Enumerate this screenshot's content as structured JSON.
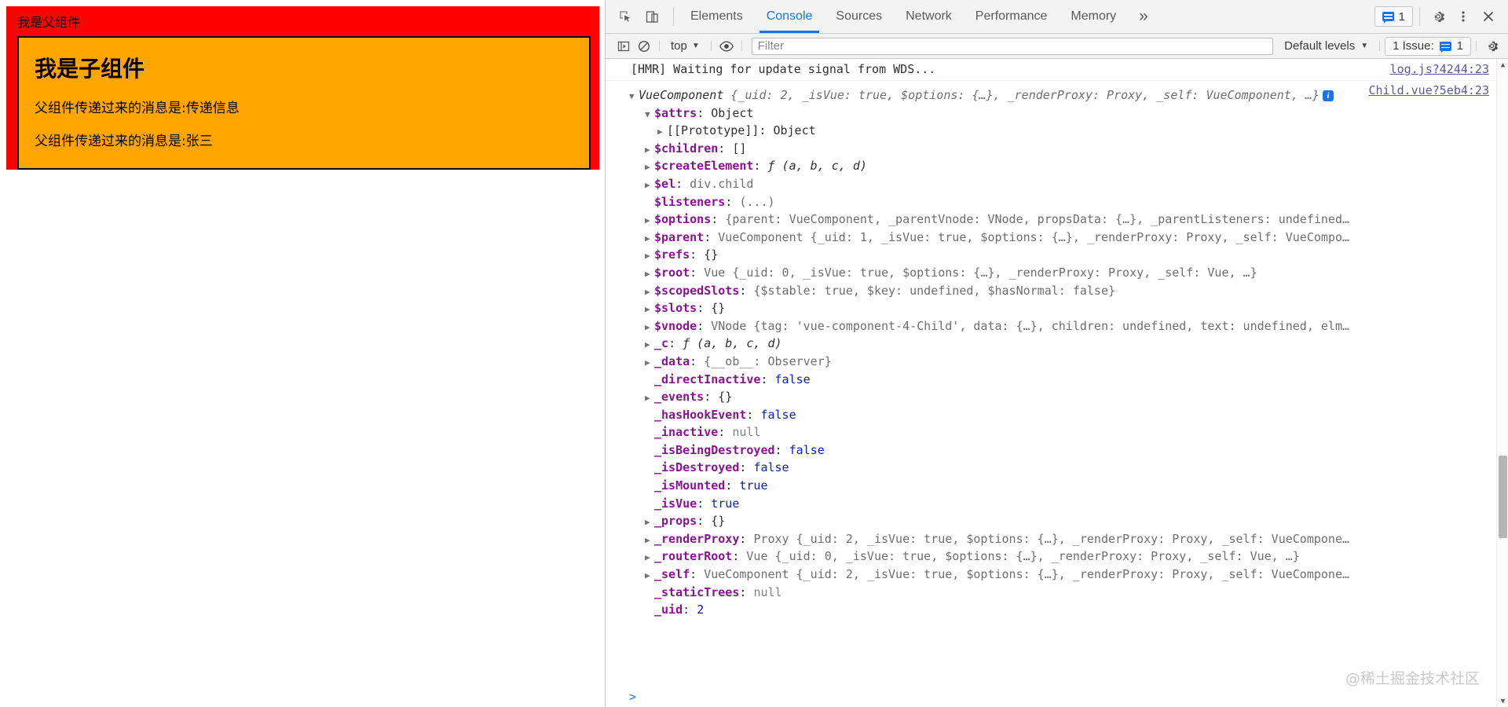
{
  "web_page": {
    "parent_title": "我是父组件",
    "parent_bg": "#ff0000",
    "child_bg": "#ffa500",
    "child_title": "我是子组件",
    "child_messages": [
      "父组件传递过来的消息是:传递信息",
      "父组件传递过来的消息是:张三"
    ]
  },
  "devtools": {
    "tabs": [
      {
        "label": "Elements",
        "active": false
      },
      {
        "label": "Console",
        "active": true
      },
      {
        "label": "Sources",
        "active": false
      },
      {
        "label": "Network",
        "active": false
      },
      {
        "label": "Performance",
        "active": false
      },
      {
        "label": "Memory",
        "active": false
      }
    ],
    "more_tabs_label": "»",
    "inspect_icon": "inspect-element-icon",
    "device_icon": "device-toolbar-icon",
    "message_count": "1",
    "settings_icon": "gear-icon",
    "kebab_icon": "more-options-icon",
    "close_icon": "close-icon",
    "console": {
      "sidebar_icon": "console-sidebar-icon",
      "clear_icon": "clear-console-icon",
      "context": "top",
      "eye_icon": "live-expressions-icon",
      "filter_value": "",
      "filter_placeholder": "Filter",
      "levels_label": "Default levels",
      "issues_label": "1 Issue:",
      "issues_count": "1",
      "console_settings_icon": "gear-icon",
      "accent_color": "#1a73e8"
    }
  },
  "console_log": {
    "hmr_message": "[HMR] Waiting for update signal from WDS...",
    "hmr_source": "log.js?4244:23",
    "object_source": "Child.vue?5eb4:23",
    "root": {
      "class_name": "VueComponent",
      "preview": " {_uid: 2, _isVue: true, $options: {…}, _renderProxy: Proxy, _self: VueComponent, …}"
    },
    "rows": [
      {
        "indent": 1,
        "arrow": "▼",
        "key": "$attrs",
        "sep": ": ",
        "value": "Object",
        "vtype": "cname"
      },
      {
        "indent": 2,
        "arrow": "▶",
        "key": "[[Prototype]]",
        "sep": ": ",
        "value": "Object",
        "vtype": "cname",
        "key_plain": true
      },
      {
        "indent": 1,
        "arrow": "▶",
        "key": "$children",
        "sep": ": ",
        "value": "[]",
        "vtype": "cname"
      },
      {
        "indent": 1,
        "arrow": "▶",
        "key": "$createElement",
        "sep": ": ",
        "value": "ƒ (a, b, c, d)",
        "vtype": "fn"
      },
      {
        "indent": 1,
        "arrow": "▶",
        "key": "$el",
        "sep": ": ",
        "value": "div.child",
        "vtype": "dim"
      },
      {
        "indent": 1,
        "arrow": "",
        "key": "$listeners",
        "sep": ": ",
        "value": "(...)",
        "vtype": "dim"
      },
      {
        "indent": 1,
        "arrow": "▶",
        "key": "$options",
        "sep": ": ",
        "value": "{parent: VueComponent, _parentVnode: VNode, propsData: {…}, _parentListeners: undefined…",
        "vtype": "dim"
      },
      {
        "indent": 1,
        "arrow": "▶",
        "key": "$parent",
        "sep": ": ",
        "value": "VueComponent {_uid: 1, _isVue: true, $options: {…}, _renderProxy: Proxy, _self: VueCompo…",
        "vtype": "dim"
      },
      {
        "indent": 1,
        "arrow": "▶",
        "key": "$refs",
        "sep": ": ",
        "value": "{}",
        "vtype": "cname"
      },
      {
        "indent": 1,
        "arrow": "▶",
        "key": "$root",
        "sep": ": ",
        "value": "Vue {_uid: 0, _isVue: true, $options: {…}, _renderProxy: Proxy, _self: Vue, …}",
        "vtype": "dim"
      },
      {
        "indent": 1,
        "arrow": "▶",
        "key": "$scopedSlots",
        "sep": ": ",
        "value": "{$stable: true, $key: undefined, $hasNormal: false}",
        "vtype": "dim"
      },
      {
        "indent": 1,
        "arrow": "▶",
        "key": "$slots",
        "sep": ": ",
        "value": "{}",
        "vtype": "cname"
      },
      {
        "indent": 1,
        "arrow": "▶",
        "key": "$vnode",
        "sep": ": ",
        "value": "VNode {tag: 'vue-component-4-Child', data: {…}, children: undefined, text: undefined, elm…",
        "vtype": "dim"
      },
      {
        "indent": 1,
        "arrow": "▶",
        "key": "_c",
        "sep": ": ",
        "value": "ƒ (a, b, c, d)",
        "vtype": "fn"
      },
      {
        "indent": 1,
        "arrow": "▶",
        "key": "_data",
        "sep": ": ",
        "value": "{__ob__: Observer}",
        "vtype": "dim"
      },
      {
        "indent": 1,
        "arrow": "",
        "key": "_directInactive",
        "sep": ": ",
        "value": "false",
        "vtype": "bool"
      },
      {
        "indent": 1,
        "arrow": "▶",
        "key": "_events",
        "sep": ": ",
        "value": "{}",
        "vtype": "cname"
      },
      {
        "indent": 1,
        "arrow": "",
        "key": "_hasHookEvent",
        "sep": ": ",
        "value": "false",
        "vtype": "bool"
      },
      {
        "indent": 1,
        "arrow": "",
        "key": "_inactive",
        "sep": ": ",
        "value": "null",
        "vtype": "nul"
      },
      {
        "indent": 1,
        "arrow": "",
        "key": "_isBeingDestroyed",
        "sep": ": ",
        "value": "false",
        "vtype": "bool"
      },
      {
        "indent": 1,
        "arrow": "",
        "key": "_isDestroyed",
        "sep": ": ",
        "value": "false",
        "vtype": "bool"
      },
      {
        "indent": 1,
        "arrow": "",
        "key": "_isMounted",
        "sep": ": ",
        "value": "true",
        "vtype": "bool"
      },
      {
        "indent": 1,
        "arrow": "",
        "key": "_isVue",
        "sep": ": ",
        "value": "true",
        "vtype": "bool"
      },
      {
        "indent": 1,
        "arrow": "▶",
        "key": "_props",
        "sep": ": ",
        "value": "{}",
        "vtype": "cname"
      },
      {
        "indent": 1,
        "arrow": "▶",
        "key": "_renderProxy",
        "sep": ": ",
        "value": "Proxy {_uid: 2, _isVue: true, $options: {…}, _renderProxy: Proxy, _self: VueCompone…",
        "vtype": "dim"
      },
      {
        "indent": 1,
        "arrow": "▶",
        "key": "_routerRoot",
        "sep": ": ",
        "value": "Vue {_uid: 0, _isVue: true, $options: {…}, _renderProxy: Proxy, _self: Vue, …}",
        "vtype": "dim"
      },
      {
        "indent": 1,
        "arrow": "▶",
        "key": "_self",
        "sep": ": ",
        "value": "VueComponent {_uid: 2, _isVue: true, $options: {…}, _renderProxy: Proxy, _self: VueCompone…",
        "vtype": "dim"
      },
      {
        "indent": 1,
        "arrow": "",
        "key": "_staticTrees",
        "sep": ": ",
        "value": "null",
        "vtype": "nul"
      },
      {
        "indent": 1,
        "arrow": "",
        "key": "_uid",
        "sep": ": ",
        "value": "2",
        "vtype": "num"
      }
    ],
    "watermark": "@稀土掘金技术社区",
    "prompt": ">"
  }
}
